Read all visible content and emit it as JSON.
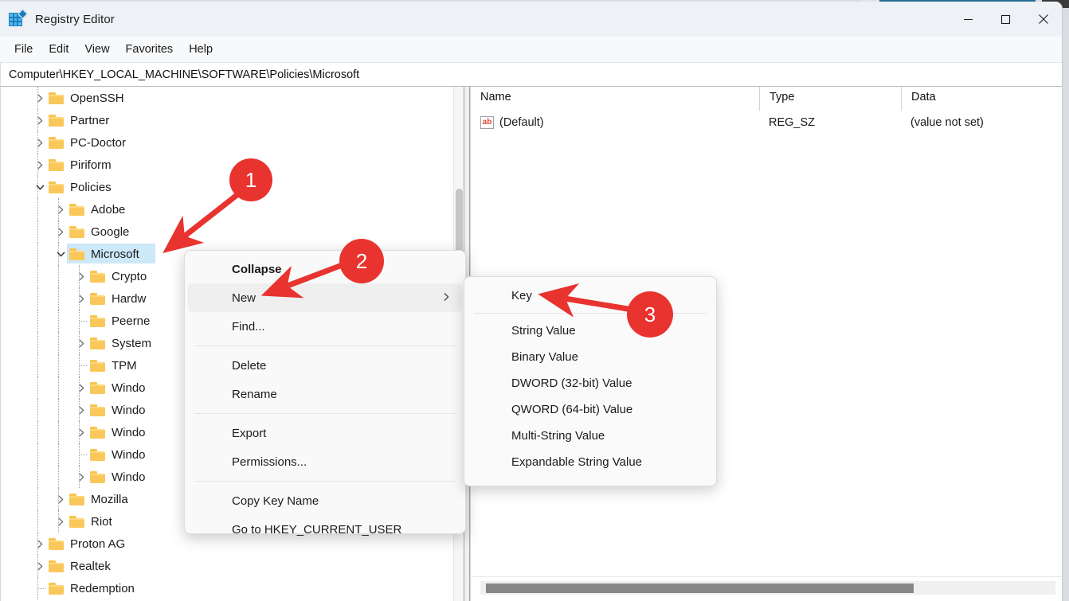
{
  "window": {
    "title": "Registry Editor",
    "app_icon": "registry-editor-icon",
    "controls": {
      "minimize": "minimize-icon",
      "maximize": "maximize-icon",
      "close": "close-icon"
    }
  },
  "menubar": {
    "items": [
      {
        "label": "File"
      },
      {
        "label": "Edit"
      },
      {
        "label": "View"
      },
      {
        "label": "Favorites"
      },
      {
        "label": "Help"
      }
    ]
  },
  "address": {
    "value": "Computer\\HKEY_LOCAL_MACHINE\\SOFTWARE\\Policies\\Microsoft"
  },
  "tree": {
    "items": [
      {
        "label": "OpenSSH",
        "depth": 2,
        "state": "collapsed",
        "selected": false
      },
      {
        "label": "Partner",
        "depth": 2,
        "state": "collapsed",
        "selected": false
      },
      {
        "label": "PC-Doctor",
        "depth": 2,
        "state": "collapsed",
        "selected": false
      },
      {
        "label": "Piriform",
        "depth": 2,
        "state": "collapsed",
        "selected": false
      },
      {
        "label": "Policies",
        "depth": 2,
        "state": "expanded",
        "selected": false
      },
      {
        "label": "Adobe",
        "depth": 3,
        "state": "collapsed",
        "selected": false
      },
      {
        "label": "Google",
        "depth": 3,
        "state": "collapsed",
        "selected": false
      },
      {
        "label": "Microsoft",
        "depth": 3,
        "state": "expanded",
        "selected": true
      },
      {
        "label": "Crypto",
        "depth": 4,
        "state": "collapsed",
        "selected": false
      },
      {
        "label": "Hardw",
        "depth": 4,
        "state": "collapsed",
        "selected": false
      },
      {
        "label": "Peerne",
        "depth": 4,
        "state": "leaf",
        "selected": false
      },
      {
        "label": "System",
        "depth": 4,
        "state": "collapsed",
        "selected": false
      },
      {
        "label": "TPM",
        "depth": 4,
        "state": "leaf",
        "selected": false
      },
      {
        "label": "Windo",
        "depth": 4,
        "state": "collapsed",
        "selected": false
      },
      {
        "label": "Windo",
        "depth": 4,
        "state": "collapsed",
        "selected": false
      },
      {
        "label": "Windo",
        "depth": 4,
        "state": "collapsed",
        "selected": false
      },
      {
        "label": "Windo",
        "depth": 4,
        "state": "leaf",
        "selected": false
      },
      {
        "label": "Windo",
        "depth": 4,
        "state": "collapsed",
        "selected": false
      },
      {
        "label": "Mozilla",
        "depth": 3,
        "state": "collapsed",
        "selected": false
      },
      {
        "label": "Riot",
        "depth": 3,
        "state": "collapsed",
        "selected": false
      },
      {
        "label": "Proton AG",
        "depth": 2,
        "state": "collapsed",
        "selected": false
      },
      {
        "label": "Realtek",
        "depth": 2,
        "state": "collapsed",
        "selected": false
      },
      {
        "label": "Redemption",
        "depth": 2,
        "state": "leaf",
        "selected": false
      }
    ]
  },
  "values_list": {
    "columns": [
      {
        "label": "Name"
      },
      {
        "label": "Type"
      },
      {
        "label": "Data"
      }
    ],
    "rows": [
      {
        "icon": "string-value-icon",
        "name": "(Default)",
        "type": "REG_SZ",
        "data": "(value not set)"
      }
    ]
  },
  "context_menu": {
    "items": [
      {
        "label": "Collapse",
        "bold": true,
        "hover": false,
        "submenu": false,
        "sep_after": false
      },
      {
        "label": "New",
        "bold": false,
        "hover": true,
        "submenu": true,
        "sep_after": false
      },
      {
        "label": "Find...",
        "bold": false,
        "hover": false,
        "submenu": false,
        "sep_after": true
      },
      {
        "label": "Delete",
        "bold": false,
        "hover": false,
        "submenu": false,
        "sep_after": false
      },
      {
        "label": "Rename",
        "bold": false,
        "hover": false,
        "submenu": false,
        "sep_after": true
      },
      {
        "label": "Export",
        "bold": false,
        "hover": false,
        "submenu": false,
        "sep_after": false
      },
      {
        "label": "Permissions...",
        "bold": false,
        "hover": false,
        "submenu": false,
        "sep_after": true
      },
      {
        "label": "Copy Key Name",
        "bold": false,
        "hover": false,
        "submenu": false,
        "sep_after": false
      },
      {
        "label": "Go to HKEY_CURRENT_USER",
        "bold": false,
        "hover": false,
        "submenu": false,
        "sep_after": false
      }
    ]
  },
  "submenu": {
    "items": [
      {
        "label": "Key",
        "sep_after": true
      },
      {
        "label": "String Value",
        "sep_after": false
      },
      {
        "label": "Binary Value",
        "sep_after": false
      },
      {
        "label": "DWORD (32-bit) Value",
        "sep_after": false
      },
      {
        "label": "QWORD (64-bit) Value",
        "sep_after": false
      },
      {
        "label": "Multi-String Value",
        "sep_after": false
      },
      {
        "label": "Expandable String Value",
        "sep_after": false
      }
    ]
  },
  "annotations": {
    "color": "#e8332e",
    "badges": [
      {
        "number": "1"
      },
      {
        "number": "2"
      },
      {
        "number": "3"
      }
    ]
  }
}
